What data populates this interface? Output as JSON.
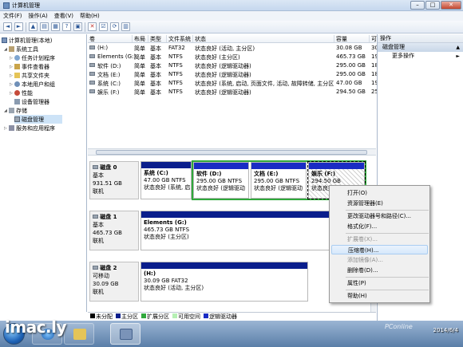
{
  "window": {
    "title": "计算机管理",
    "controls": [
      "–",
      "□",
      "✕"
    ]
  },
  "menu": [
    "文件(F)",
    "操作(A)",
    "查看(V)",
    "帮助(H)"
  ],
  "toolbar_icons": [
    "back-icon",
    "forward-icon",
    "up-icon",
    "show-tree-icon",
    "properties-icon",
    "help-icon",
    "connect-icon",
    "delete-icon",
    "props-icon",
    "refresh-icon",
    "export-icon"
  ],
  "tree": {
    "root": "计算机管理(本地)",
    "system_tools": "系统工具",
    "task_scheduler": "任务计划程序",
    "event_viewer": "事件查看器",
    "shared_folders": "共享文件夹",
    "local_users": "本地用户和组",
    "performance": "性能",
    "device_manager": "设备管理器",
    "storage": "存储",
    "disk_management": "磁盘管理",
    "services": "服务和应用程序"
  },
  "volume_columns": [
    "卷",
    "布局",
    "类型",
    "文件系统",
    "状态",
    "容量",
    "可"
  ],
  "volumes": [
    {
      "name": "(H:)",
      "layout": "简单",
      "type": "基本",
      "fs": "FAT32",
      "status": "状态良好 (活动, 主分区)",
      "capacity": "30.08 GB",
      "free": "30"
    },
    {
      "name": "Elements (G:)",
      "layout": "简单",
      "type": "基本",
      "fs": "NTFS",
      "status": "状态良好 (主分区)",
      "capacity": "465.73 GB",
      "free": "19"
    },
    {
      "name": "软件 (D:)",
      "layout": "简单",
      "type": "基本",
      "fs": "NTFS",
      "status": "状态良好 (逻辑驱动器)",
      "capacity": "295.00 GB",
      "free": "18"
    },
    {
      "name": "文档 (E:)",
      "layout": "简单",
      "type": "基本",
      "fs": "NTFS",
      "status": "状态良好 (逻辑驱动器)",
      "capacity": "295.00 GB",
      "free": "18"
    },
    {
      "name": "系统 (C:)",
      "layout": "简单",
      "type": "基本",
      "fs": "NTFS",
      "status": "状态良好 (系统, 启动, 页面文件, 活动, 故障转储, 主分区)",
      "capacity": "47.00 GB",
      "free": "19"
    },
    {
      "name": "娱乐 (F:)",
      "layout": "简单",
      "type": "基本",
      "fs": "NTFS",
      "status": "状态良好 (逻辑驱动器)",
      "capacity": "294.50 GB",
      "free": "25"
    }
  ],
  "disks": [
    {
      "name": "磁盘 0",
      "type": "基本",
      "size": "931.51 GB",
      "state": "联机",
      "partitions": [
        {
          "title": "系统 (C:)",
          "size": "47.00 GB NTFS",
          "status": "状态良好 (系统, 启"
        },
        {
          "title": "软件 (D:)",
          "size": "295.00 GB NTFS",
          "status": "状态良好 (逻辑驱动"
        },
        {
          "title": "文档 (E:)",
          "size": "295.00 GB NTFS",
          "status": "状态良好 (逻辑驱动"
        },
        {
          "title": "娱乐 (F:)",
          "size": "294.50 GB",
          "status": "状态良好"
        }
      ]
    },
    {
      "name": "磁盘 1",
      "type": "基本",
      "size": "465.73 GB",
      "state": "联机",
      "partitions": [
        {
          "title": "Elements (G:)",
          "size": "465.73 GB NTFS",
          "status": "状态良好 (主分区)"
        }
      ]
    },
    {
      "name": "磁盘 2",
      "type": "可移动",
      "size": "30.09 GB",
      "state": "联机",
      "partitions": [
        {
          "title": "(H:)",
          "size": "30.09 GB FAT32",
          "status": "状态良好 (活动, 主分区)"
        }
      ]
    }
  ],
  "legend": [
    {
      "label": "未分配",
      "color": "#000000"
    },
    {
      "label": "主分区",
      "color": "#0a1e8c"
    },
    {
      "label": "扩展分区",
      "color": "#2fa83b"
    },
    {
      "label": "可用空间",
      "color": "#b6f0b4"
    },
    {
      "label": "逻辑驱动器",
      "color": "#1a2cc4"
    }
  ],
  "actions": {
    "header": "操作",
    "section": "磁盘管理",
    "more": "更多操作"
  },
  "context_menu": [
    {
      "label": "打开(O)",
      "enabled": true
    },
    {
      "label": "资源管理器(E)",
      "enabled": true
    },
    {
      "label": "更改驱动器号和路径(C)...",
      "enabled": true
    },
    {
      "label": "格式化(F)...",
      "enabled": true
    },
    {
      "label": "扩展卷(X)...",
      "enabled": false
    },
    {
      "label": "压缩卷(H)...",
      "enabled": true
    },
    {
      "label": "添加镜像(A)...",
      "enabled": false
    },
    {
      "label": "删除卷(D)...",
      "enabled": true
    },
    {
      "label": "属性(P)",
      "enabled": true
    },
    {
      "label": "帮助(H)",
      "enabled": true
    }
  ],
  "taskbar": {
    "watermark": "imac.ly",
    "clock_time": "",
    "clock_date": "2014/6/4",
    "brand": "PConline"
  }
}
